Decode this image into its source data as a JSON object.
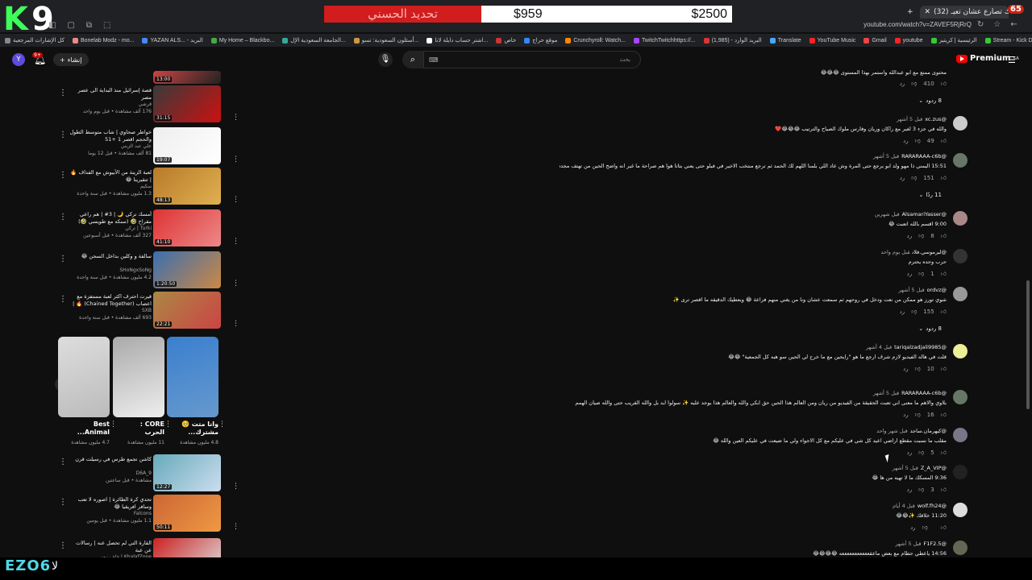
{
  "overlay": {
    "logo_k": "K",
    "logo_9": "9",
    "donation_label": "تحديد الحسني",
    "donation_current": "$959",
    "donation_goal": "$2500",
    "streamer_tag": "EZO6",
    "streamer_ar": "لا"
  },
  "browser": {
    "tab_title": "(32) لعبة تجربك تصارع عشان تعيـ",
    "tab_badge": "65",
    "address": "youtube.com/watch?v=ZAVEF5RjRrQ",
    "bookmarks": [
      {
        "label": "كل الإشارات المرجعية",
        "color": "#888"
      },
      {
        "label": "Bonelab Modz - mo...",
        "color": "#e88"
      },
      {
        "label": "YAZAN ALS... - البريد",
        "color": "#48f"
      },
      {
        "label": "My Home – Blackbo...",
        "color": "#4a4"
      },
      {
        "label": "الجامعة السعودية الإل...",
        "color": "#3a9"
      },
      {
        "label": "أسئلون السعودية: تسو...",
        "color": "#c94"
      },
      {
        "label": "اشتر حساب دايلة لانا...",
        "color": "#fff"
      },
      {
        "label": "خاص",
        "color": "#c33"
      },
      {
        "label": "موقع حراج",
        "color": "#38f"
      },
      {
        "label": "Crunchyroll: Watch...",
        "color": "#f80"
      },
      {
        "label": "TwitchTwitchhttps://...",
        "color": "#a4f"
      },
      {
        "label": "(1,985) - البريد الوارد",
        "color": "#d33"
      },
      {
        "label": "Translate",
        "color": "#4af"
      },
      {
        "label": "YouTube Music",
        "color": "#f22"
      },
      {
        "label": "Gmail",
        "color": "#e44"
      },
      {
        "label": "youtube",
        "color": "#f22"
      },
      {
        "label": "الرئيسية | كريتيز",
        "color": "#3c3"
      },
      {
        "label": "Stream - Kick Dashb...",
        "color": "#3c3"
      },
      {
        "label": "Kick",
        "color": "#3c3"
      },
      {
        "label": "Google",
        "color": "#48f"
      }
    ]
  },
  "header": {
    "avatar_letter": "Y",
    "notif_count": "9+",
    "create_label": "إنشاء",
    "search_placeholder": "بحث",
    "brand": "Premium",
    "brand_region": "SA"
  },
  "recommendations": [
    {
      "title": "قصة إسرائيل بدون الشايب الكاملة",
      "channel": "",
      "meta": "",
      "duration": "13:00",
      "thumb": [
        "#c44",
        "#222"
      ]
    },
    {
      "title": "قصة إسرائيل منذ البداية الى عصر مصر",
      "channel": "قرشي",
      "meta": "176 ألف مشاهدة • قبل يوم واحد",
      "duration": "31:15",
      "thumb": [
        "#3a3a3a",
        "#c11"
      ]
    },
    {
      "title": "خواطر صحاوي | شاب متوسط الطول والحجم اقصر 1 +51",
      "channel": "علي عبد الزبني",
      "meta": "81 ألف مشاهدة • قبل 12 يوما",
      "duration": "19:07",
      "thumb": [
        "#eee",
        "#fff"
      ]
    },
    {
      "title": "لعبة الزينة من الأبيوش مع الفداف 🔥 | تتقيرينا 😂",
      "channel": "سكيم",
      "meta": "1.3 مليون مشاهدة • قبل سنة واحدة",
      "duration": "48:13",
      "thumb": [
        "#b87a2a",
        "#e0b050"
      ]
    },
    {
      "title": "أمسك تركي 🌙 | 3# | هم راعي مقراح 🤣 (سنكه مع طويسي 🤣)",
      "channel": "Turki | تركي",
      "meta": "327 ألف مشاهدة • قبل أسبوعين",
      "duration": "41:10",
      "thumb": [
        "#d33",
        "#e88"
      ]
    },
    {
      "title": "سالفة و وكلين بداخل السجن 😂",
      "channel": "SHoNgxSoNg",
      "meta": "4.2 مليون مشاهدة • قبل سنة واحدة",
      "duration": "1:20:50",
      "thumb": [
        "#3a6fb0",
        "#c84"
      ]
    },
    {
      "title": "قيرت احترف اكثر لعبة مستفزة مع اعصاب (Chained Together) 🔥 | قصر",
      "channel": "SXB",
      "meta": "693 ألف مشاهدة • قبل سنة واحدة",
      "duration": "22:21",
      "thumb": [
        "#a84",
        "#c44"
      ]
    },
    {
      "title": "كاشن تجمع طرس في رسيلت قرن",
      "channel": "D6A_9",
      "meta": "مشاهدة • قبل ساعتين",
      "duration": "12:27",
      "thumb": [
        "#6ab",
        "#cde"
      ]
    },
    {
      "title": "تحدي كرة الطائرة | اصوره لا تعب وسافر افريقيا 😂",
      "channel": "Falcons",
      "meta": "1.1 مليون مشاهدة • قبل يومين",
      "duration": "50:11",
      "thumb": [
        "#c63",
        "#e94"
      ]
    },
    {
      "title": "القارة التي لم تحصل عنه | رسالات عن عبة",
      "channel": "KhalafZone | خلف زون",
      "meta": "",
      "duration": "",
      "thumb": [
        "#c22",
        "#ddd"
      ]
    }
  ],
  "shorts": [
    {
      "title": "Best Animal...",
      "views": "4.7 مليون مشاهدة",
      "bg": [
        "#ddd",
        "#bbb"
      ]
    },
    {
      "title": "CORE : الحرب",
      "views": "11 مليون مشاهدة",
      "bg": [
        "#aaa",
        "#eee"
      ]
    },
    {
      "title": "وانا متت 🥺 مشترك...",
      "views": "4.8 مليون مشاهدة",
      "bg": [
        "#3a7fd0",
        "#69c"
      ]
    }
  ],
  "comments": [
    {
      "author": "",
      "time": "",
      "text": "محتوى ممتع مع ابو عبدالله واستمر بهذا المستوى 😂😂😂",
      "likes": "410",
      "replies": "8 ردود",
      "avatar": "#555"
    },
    {
      "author": "@xc.zus",
      "time": "قبل 5 أشهر",
      "text": "والله في جزء 3 لغير مع راكان وريان وفارس ملوك الصياح والترتيب 😂😂😂❤️",
      "likes": "49",
      "replies": "",
      "avatar": "#ccc"
    },
    {
      "author": "@RARARAAA-c6b",
      "time": "قبل 5 أشهر",
      "text": "15:51 اليمني ذا مهو ولد ابو يرجع حتى المرة وش عاد اللي بلمنا اللهم لك الحمد ثم ترجع منتخب الاخير في فيلو حتى يعني بتاتا هوا هم صراحة ما غير انه واضح الحين من تهتف مجددا انت تبغى العرب",
      "likes": "151",
      "replies": "11 ردًا",
      "avatar": "#676"
    },
    {
      "author": "@AlsamariYasser",
      "time": "قبل شهرين",
      "text": "9:00 اقسم بالله اتعبت 😂",
      "likes": "8",
      "replies": "",
      "avatar": "#a88"
    },
    {
      "author": "@ليرموسي.فلان",
      "time": "قبل يوم واحد",
      "text": "حرب وحده يحترم",
      "likes": "1",
      "replies": "",
      "avatar": "#333"
    },
    {
      "author": "@ordvz",
      "time": "قبل 5 أشهر",
      "text": "شوي تورز هو ممكن من نعت ودخل في روحهم ثم سمعت عشان ونا من يغني منهم فزاعة 😂 وبعطيك الدقيقه ما اقصر ترى ✨",
      "likes": "155",
      "replies": "8 ردود",
      "avatar": "#999"
    },
    {
      "author": "@tariqalzadjali9985",
      "time": "قبل 4 أشهر",
      "text": "قلت في هاله الفيديو لازم شرف ارجع ما هو \"رايحين مع ما خرج لي الحين سو هبه كل الجمعية\" 😂😂",
      "likes": "10",
      "replies": "",
      "avatar": "#ee9"
    },
    {
      "author": "@RARARAAA-c6b",
      "time": "قبل 5 أشهر",
      "text": "بلاوي والاهم ما معنى اني تعبت الحقيقة من الفيديو من ريان ومن العالم هذا الحين حق ابكي والله والعالم هذا يوجد عليه ✨ سولوا ابد بل والله القريب حتى والله صيان الهمم",
      "likes": "16",
      "replies": "",
      "avatar": "#676"
    },
    {
      "author": "@كيهرمان.ساجد",
      "time": "قبل شهر واحد",
      "text": "مقلب ما نسبت مقطع اراضي اعيد كل شي في عليكم مع كل الاجواء ولي ما ضيعت في عليكم العين والله 😂",
      "likes": "5",
      "replies": "",
      "avatar": "#778"
    },
    {
      "author": "@Z_A_VIP",
      "time": "قبل 5 أشهر",
      "text": "9:36 المسكك ما لا تهيه من ها 😂",
      "likes": "3",
      "replies": "",
      "avatar": "#222"
    },
    {
      "author": "@wolf.fh24",
      "time": "قبل 4 أيام",
      "text": "11:20 خلاقك ✨😂😂",
      "likes": "",
      "replies": "",
      "avatar": "#ddd"
    },
    {
      "author": "@F1F2.5",
      "time": "قبل 5 أشهر",
      "text": "14:56 ياعطي حطام مع بعض ماعقعععععععععععه 😂😂😂😂",
      "likes": "",
      "replies": "",
      "avatar": "#665"
    }
  ]
}
